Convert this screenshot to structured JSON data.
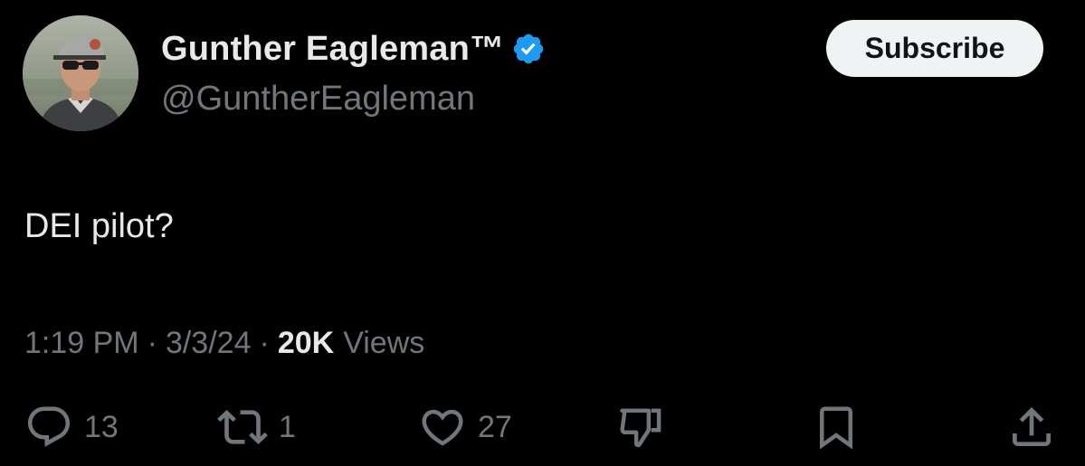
{
  "author": {
    "display_name": "Gunther Eagleman™",
    "handle": "@GuntherEagleman",
    "verified": true,
    "avatar_icon": "profile-photo"
  },
  "header": {
    "subscribe_label": "Subscribe"
  },
  "tweet": {
    "text": "DEI pilot?"
  },
  "meta": {
    "time": "1:19 PM",
    "separator": "·",
    "date": "3/3/24",
    "views_count": "20K",
    "views_label": "Views"
  },
  "actions": {
    "replies": {
      "icon": "reply-icon",
      "count": "13"
    },
    "reposts": {
      "icon": "repost-icon",
      "count": "1"
    },
    "likes": {
      "icon": "heart-icon",
      "count": "27"
    },
    "dislike": {
      "icon": "thumbs-down-icon"
    },
    "bookmark": {
      "icon": "bookmark-icon"
    },
    "share": {
      "icon": "share-icon"
    }
  },
  "colors": {
    "background": "#000000",
    "primary_text": "#e7e9ea",
    "secondary_text": "#71767b",
    "verified_blue": "#1d9bf0",
    "button_bg": "#eff3f4",
    "button_text": "#0f1419"
  }
}
